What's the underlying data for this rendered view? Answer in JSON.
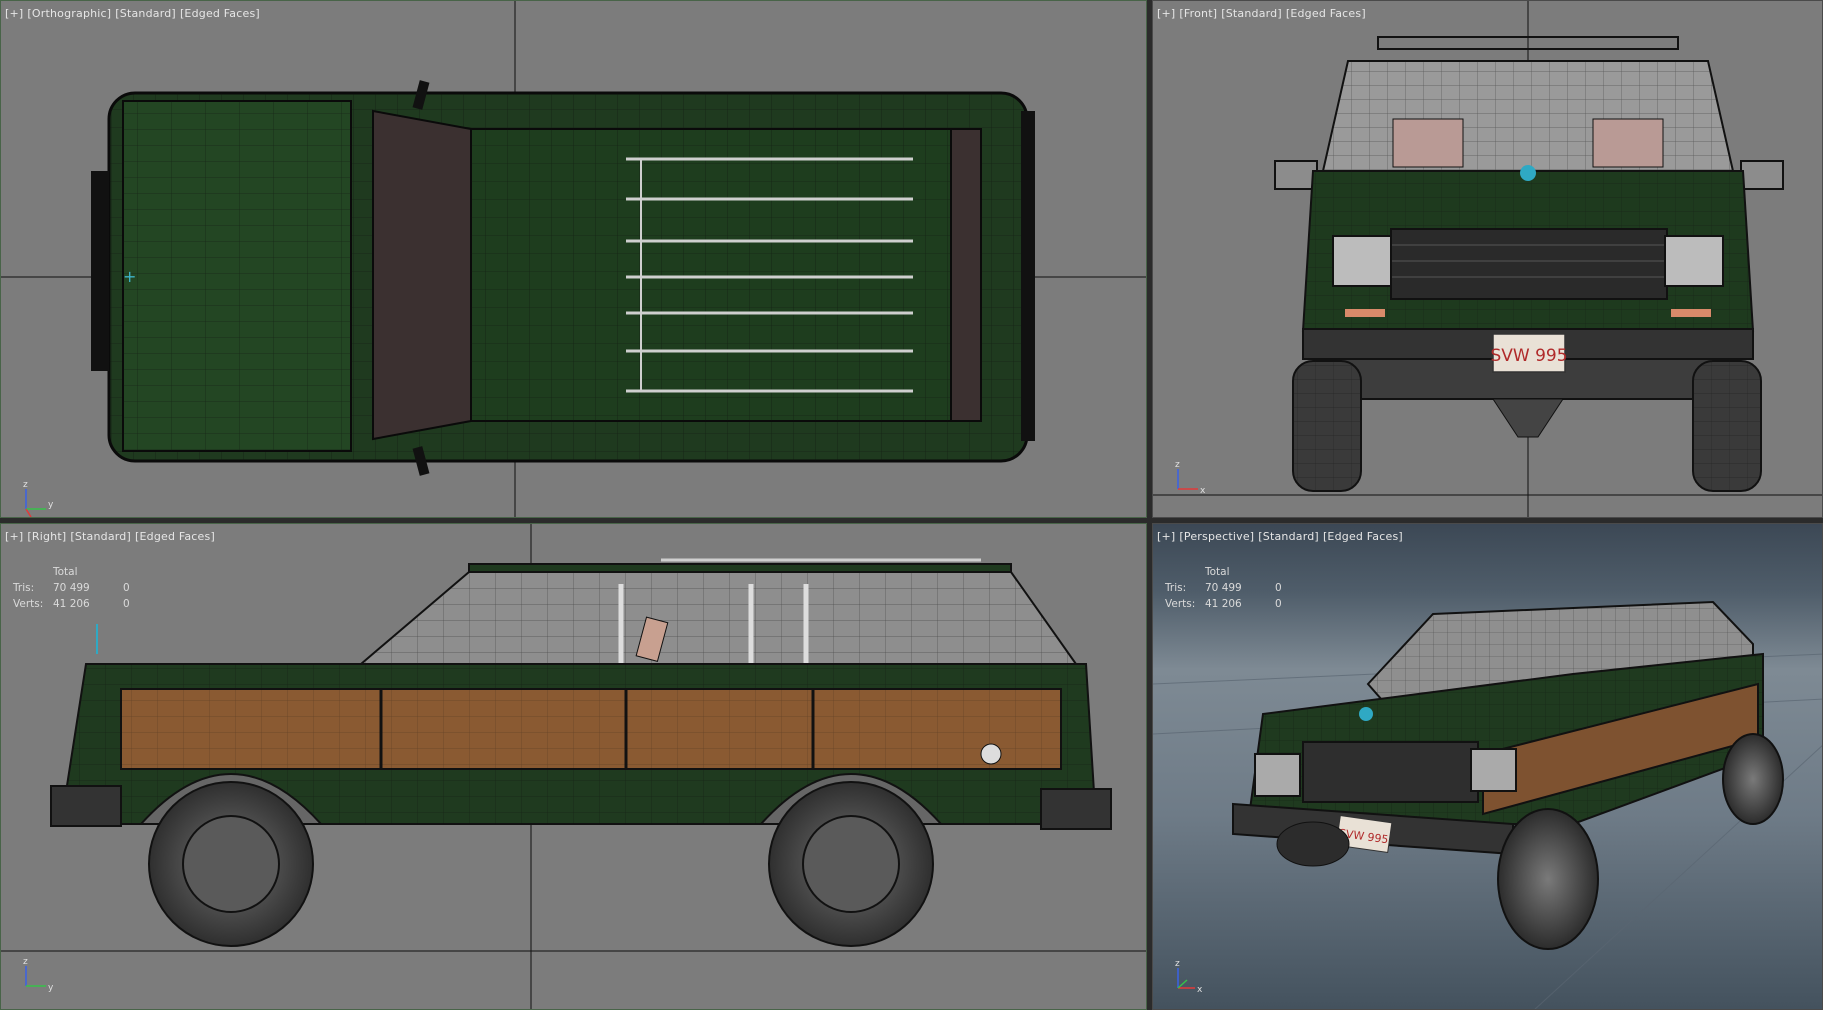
{
  "viewports": {
    "top_left": {
      "labels": [
        "[+]",
        "[Orthographic]",
        "[Standard]",
        "[Edged Faces]"
      ],
      "axis": {
        "a": "z",
        "b": "y"
      }
    },
    "top_right": {
      "labels": [
        "[+]",
        "[Front]",
        "[Standard]",
        "[Edged Faces]"
      ],
      "axis": {
        "a": "z",
        "b": "x"
      },
      "license_plate": "SVW 995"
    },
    "bottom_left": {
      "labels": [
        "[+]",
        "[Right]",
        "[Standard]",
        "[Edged Faces]"
      ],
      "axis": {
        "a": "z",
        "b": "y"
      },
      "stats": {
        "header": "Total",
        "rows": [
          {
            "label": "Tris:",
            "total": "70 499",
            "selected": "0"
          },
          {
            "label": "Verts:",
            "total": "41 206",
            "selected": "0"
          }
        ]
      }
    },
    "bottom_right": {
      "labels": [
        "[+]",
        "[Perspective]",
        "[Standard]",
        "[Edged Faces]"
      ],
      "axis": {
        "a": "z",
        "b": "x"
      },
      "license_plate": "SVW 995",
      "stats": {
        "header": "Total",
        "rows": [
          {
            "label": "Tris:",
            "total": "70 499",
            "selected": "0"
          },
          {
            "label": "Verts:",
            "total": "41 206",
            "selected": "0"
          }
        ]
      }
    }
  },
  "colors": {
    "body_green": "#1f3a1f",
    "wood": "#8a5a32",
    "viewport_gray": "#7c7c7c",
    "wire": "#0c0c0c"
  }
}
